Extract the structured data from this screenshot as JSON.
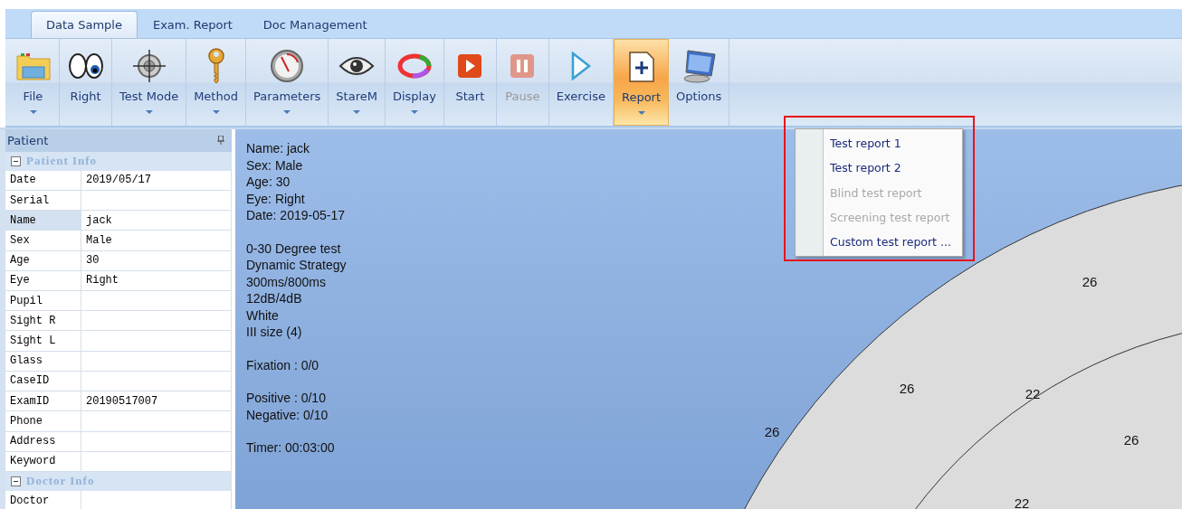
{
  "tabs": [
    {
      "label": "Data Sample",
      "selected": true
    },
    {
      "label": "Exam. Report",
      "selected": false
    },
    {
      "label": "Doc Management",
      "selected": false
    }
  ],
  "ribbon": [
    {
      "label": "File",
      "kind": "folder",
      "dropdown": true,
      "disabled": false,
      "pressed": false
    },
    {
      "label": "Right",
      "kind": "eyes",
      "dropdown": false,
      "disabled": false,
      "pressed": false
    },
    {
      "label": "Test Mode",
      "kind": "crosshair",
      "dropdown": true,
      "disabled": false,
      "pressed": false
    },
    {
      "label": "Method",
      "kind": "key",
      "dropdown": true,
      "disabled": false,
      "pressed": false
    },
    {
      "label": "Parameters",
      "kind": "gauge",
      "dropdown": true,
      "disabled": false,
      "pressed": false
    },
    {
      "label": "StareM",
      "kind": "eye",
      "dropdown": true,
      "disabled": false,
      "pressed": false
    },
    {
      "label": "Display",
      "kind": "palette",
      "dropdown": true,
      "disabled": false,
      "pressed": false
    },
    {
      "label": "Start",
      "kind": "play",
      "dropdown": false,
      "disabled": false,
      "pressed": false
    },
    {
      "label": "Pause",
      "kind": "pause",
      "dropdown": false,
      "disabled": true,
      "pressed": false
    },
    {
      "label": "Exercise",
      "kind": "triangle",
      "dropdown": false,
      "disabled": false,
      "pressed": false
    },
    {
      "label": "Report",
      "kind": "report",
      "dropdown": true,
      "disabled": false,
      "pressed": true
    },
    {
      "label": "Options",
      "kind": "monitor",
      "dropdown": false,
      "disabled": false,
      "pressed": false
    }
  ],
  "panel": {
    "title": "Patient",
    "categories": [
      {
        "title": "Patient Info",
        "expanded": true,
        "rows": [
          {
            "label": "Date",
            "value": "2019/05/17",
            "selected": false
          },
          {
            "label": "Serial",
            "selected": false
          },
          {
            "label": "Name",
            "value": "jack",
            "selected": true
          },
          {
            "label": "Sex",
            "value": "Male",
            "selected": false
          },
          {
            "label": "Age",
            "value": "30",
            "selected": false
          },
          {
            "label": "Eye",
            "value": "Right",
            "selected": false
          },
          {
            "label": "Pupil",
            "selected": false
          },
          {
            "label": "Sight R",
            "selected": false
          },
          {
            "label": "Sight L",
            "selected": false
          },
          {
            "label": "Glass",
            "selected": false
          },
          {
            "label": "CaseID",
            "selected": false
          },
          {
            "label": "ExamID",
            "value": "20190517007",
            "selected": false
          },
          {
            "label": "Phone",
            "selected": false
          },
          {
            "label": "Address",
            "selected": false
          },
          {
            "label": "Keyword",
            "selected": false
          }
        ]
      },
      {
        "title": "Doctor Info",
        "expanded": true,
        "rows": [
          {
            "label": "Doctor",
            "selected": false
          }
        ]
      }
    ]
  },
  "summary": [
    [
      "Name: jack",
      "Sex: Male",
      "Age: 30",
      "Eye: Right",
      "Date: 2019-05-17"
    ],
    [
      "0-30 Degree test",
      "Dynamic Strategy",
      "300ms/800ms",
      "12dB/4dB",
      "White",
      "III size (4)"
    ],
    [
      "Fixation : 0/0"
    ],
    [
      "Positive : 0/10",
      "Negative: 0/10"
    ],
    [
      "Timer: 00:03:00"
    ]
  ],
  "field_values": [
    "26",
    "26",
    "22",
    "26",
    "26",
    "22"
  ],
  "report_menu": [
    {
      "label": "Test report 1",
      "disabled": false
    },
    {
      "label": "Test report 2",
      "disabled": false
    },
    {
      "label": "Blind test report",
      "disabled": true
    },
    {
      "label": "Screening test report",
      "disabled": true
    },
    {
      "label": "Custom test report ...",
      "disabled": false
    }
  ]
}
